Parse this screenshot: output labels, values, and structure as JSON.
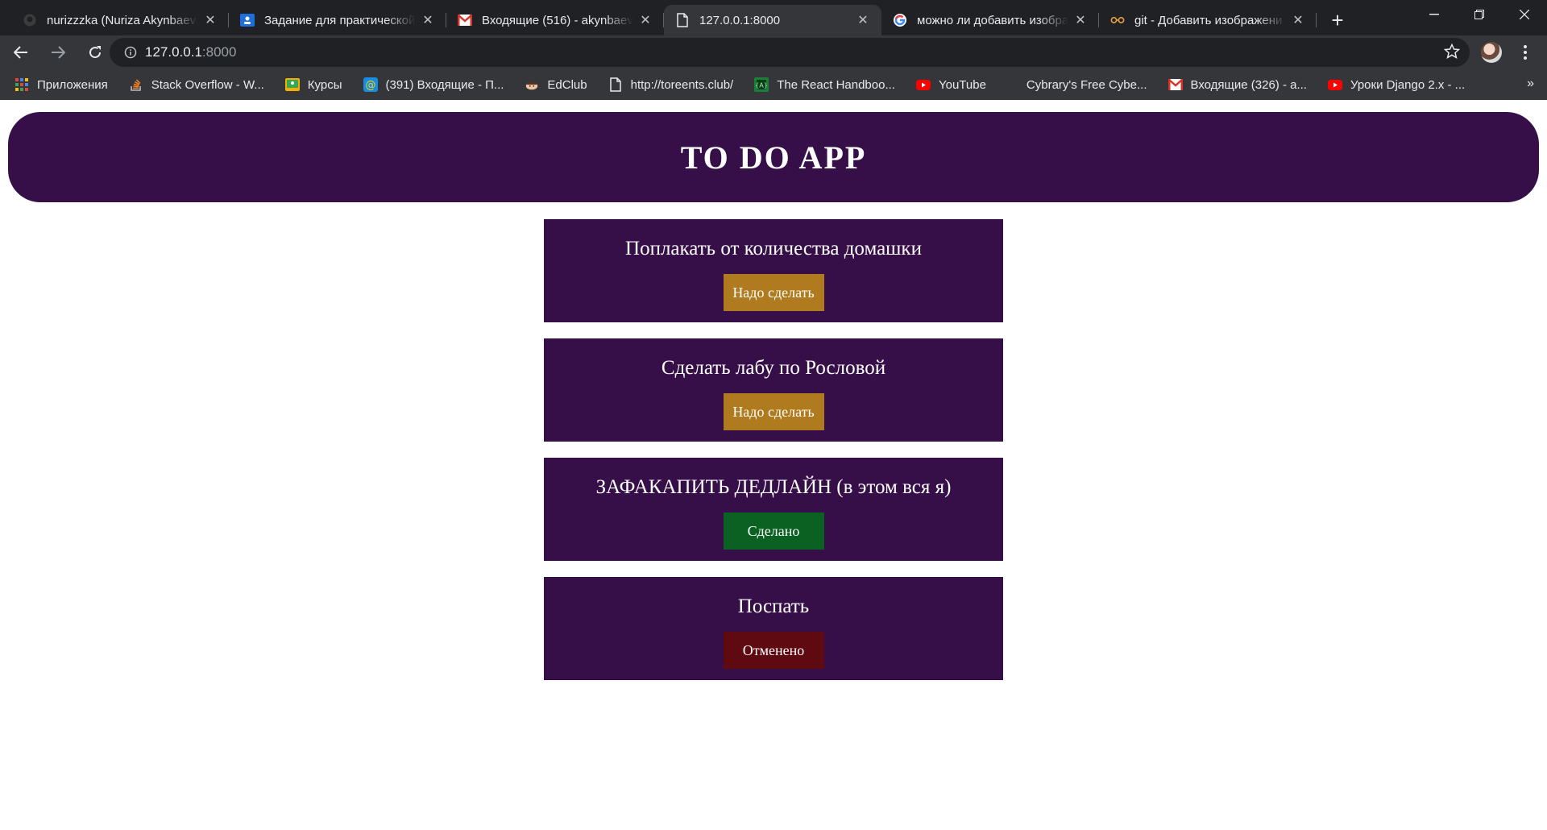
{
  "browser": {
    "tabs": [
      {
        "title": "nurizzzka (Nuriza Akynbaeva)",
        "icon": "github-icon"
      },
      {
        "title": "Задание для практической р",
        "icon": "classroom-icon"
      },
      {
        "title": "Входящие (516) - akynbaeva",
        "icon": "gmail-icon"
      },
      {
        "title": "127.0.0.1:8000",
        "icon": "page-icon",
        "active": true
      },
      {
        "title": "можно ли добавить изобра",
        "icon": "google-icon"
      },
      {
        "title": "git - Добавить изображени",
        "icon": "glasses-icon"
      }
    ],
    "address": {
      "host": "127.0.0.1",
      "port": ":8000"
    },
    "bookmarks": [
      {
        "label": "Приложения",
        "icon": "apps-grid-icon"
      },
      {
        "label": "Stack Overflow - W...",
        "icon": "stackoverflow-icon"
      },
      {
        "label": "Курсы",
        "icon": "classroom-icon"
      },
      {
        "label": "(391) Входящие - П...",
        "icon": "mail-at-icon"
      },
      {
        "label": "EdClub",
        "icon": "edclub-icon"
      },
      {
        "label": "http://toreents.club/",
        "icon": "page-icon"
      },
      {
        "label": "The React Handboo...",
        "icon": "react-book-icon"
      },
      {
        "label": "YouTube",
        "icon": "youtube-icon"
      },
      {
        "label": "Cybrary's Free Cybe...",
        "icon": "none"
      },
      {
        "label": "Входящие (326) - a...",
        "icon": "gmail-icon"
      },
      {
        "label": "Уроки Django 2.x - ...",
        "icon": "youtube-icon"
      }
    ],
    "bookmarks_more": "»"
  },
  "app": {
    "title": "TO DO APP",
    "tasks": [
      {
        "text": "Поплакать от количества домашки",
        "status": "Надо сделать",
        "color": "#b07a1e"
      },
      {
        "text": "Сделать лабу по Рословой",
        "status": "Надо сделать",
        "color": "#b07a1e"
      },
      {
        "text": "ЗАФАКАПИТЬ ДЕДЛАЙН (в этом вся я)",
        "status": "Сделано",
        "color": "#0b6121"
      },
      {
        "text": "Поспать",
        "status": "Отменено",
        "color": "#5e0a10"
      }
    ]
  },
  "colors": {
    "header_bg": "#370f48",
    "card_bg": "#370f48"
  }
}
